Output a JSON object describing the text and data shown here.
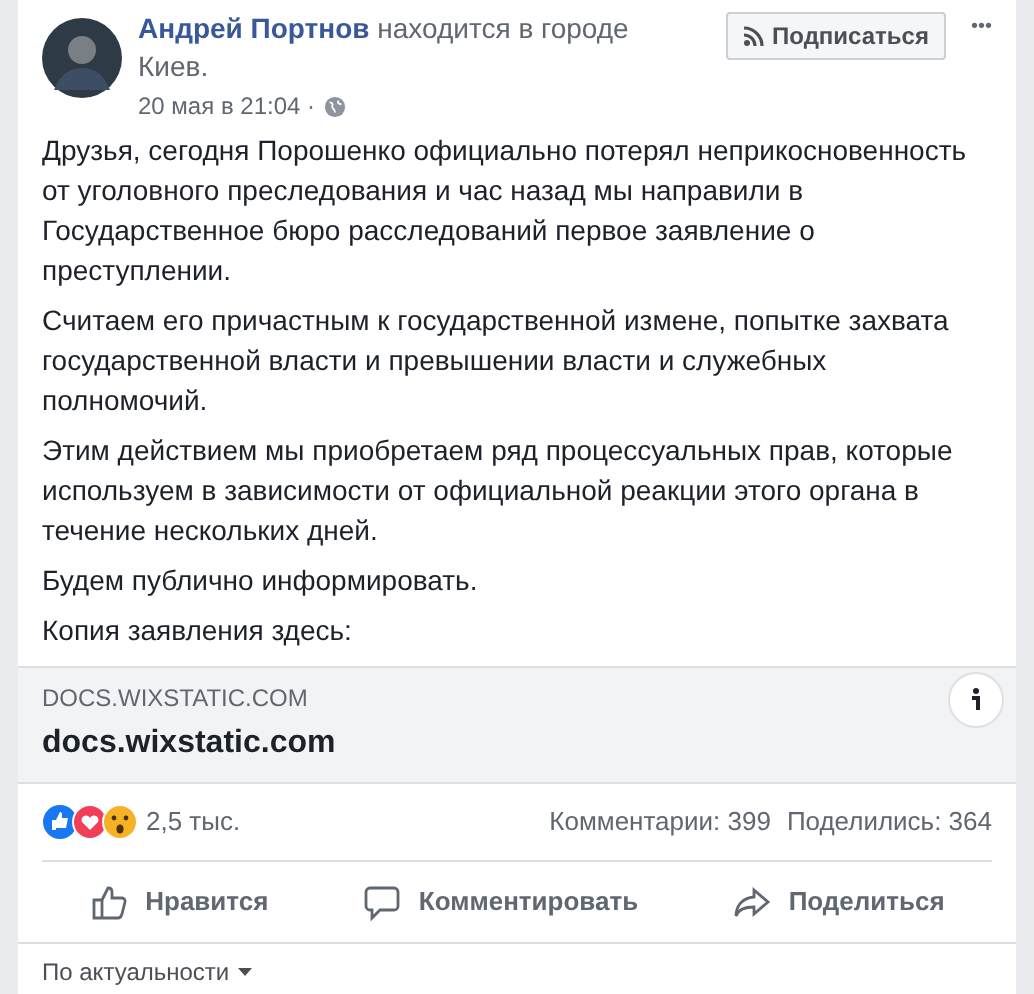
{
  "post": {
    "author": "Андрей Портнов",
    "location_text": "находится в городе",
    "city": "Киев.",
    "time": "20 мая в 21:04 ·",
    "follow_button": "Подписаться",
    "more_button": "•••",
    "paragraphs": [
      "Друзья, сегодня Порошенко официально потерял неприкосновенность от уголовного преследования и час назад мы направили в Государственное бюро расследований первое заявление о преступлении.",
      "Считаем его причастным к государственной измене, попытке захвата государственной власти и превышении власти и служебных полномочий.",
      "Этим действием мы приобретаем ряд процессуальных прав, которые используем в зависимости от официальной реакции этого органа в течение нескольких дней.",
      "Будем публично информировать.",
      "Копия заявления здесь:"
    ],
    "link": {
      "domain": "DOCS.WIXSTATIC.COM",
      "title": "docs.wixstatic.com"
    },
    "reactions_count": "2,5 тыс.",
    "comments": "Комментарии: 399",
    "shares": "Поделились: 364",
    "actions": [
      {
        "kind": "like",
        "label": "Нравится"
      },
      {
        "kind": "comment",
        "label": "Комментировать"
      },
      {
        "kind": "share",
        "label": "Поделиться"
      }
    ],
    "sort": "По актуальности"
  }
}
